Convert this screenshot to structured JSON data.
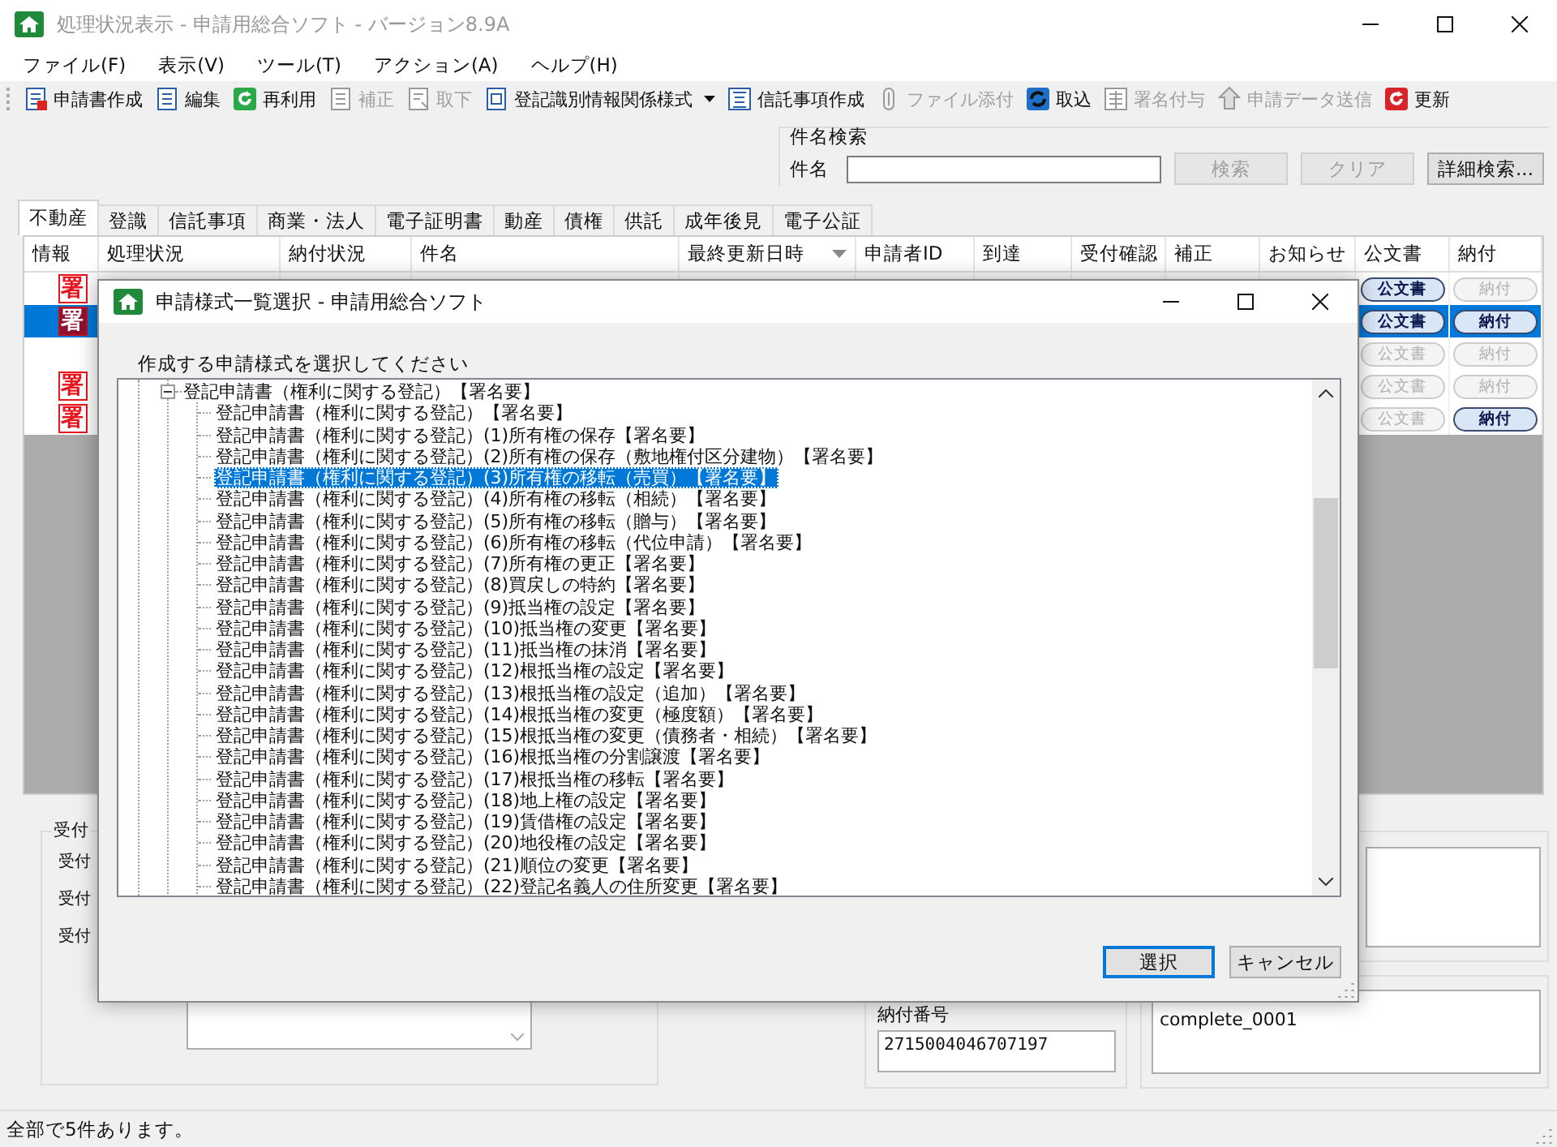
{
  "window": {
    "title": "処理状況表示 - 申請用総合ソフト - バージョン8.9A"
  },
  "menu": [
    "ファイル(F)",
    "表示(V)",
    "ツール(T)",
    "アクション(A)",
    "ヘルプ(H)"
  ],
  "toolbar": [
    {
      "label": "申請書作成",
      "disabled": false,
      "kind": "button"
    },
    {
      "label": "編集",
      "disabled": false,
      "kind": "button"
    },
    {
      "label": "再利用",
      "disabled": false,
      "kind": "button"
    },
    {
      "label": "補正",
      "disabled": true,
      "kind": "button"
    },
    {
      "label": "取下",
      "disabled": true,
      "kind": "button"
    },
    {
      "label": "登記識別情報関係様式",
      "disabled": false,
      "kind": "dropdown"
    },
    {
      "label": "信託事項作成",
      "disabled": false,
      "kind": "button"
    },
    {
      "label": "ファイル添付",
      "disabled": true,
      "kind": "button"
    },
    {
      "label": "取込",
      "disabled": false,
      "kind": "button"
    },
    {
      "label": "署名付与",
      "disabled": true,
      "kind": "button"
    },
    {
      "label": "申請データ送信",
      "disabled": true,
      "kind": "button"
    },
    {
      "label": "更新",
      "disabled": false,
      "kind": "button"
    }
  ],
  "search": {
    "title": "件名検索",
    "label": "件名",
    "buttons": [
      {
        "label": "検索",
        "disabled": true
      },
      {
        "label": "クリア",
        "disabled": true
      },
      {
        "label": "詳細検索...",
        "disabled": false
      }
    ]
  },
  "tabs": [
    {
      "label": "不動産",
      "selected": true
    },
    {
      "label": "登識",
      "selected": false
    },
    {
      "label": "信託事項",
      "selected": false
    },
    {
      "label": "商業・法人",
      "selected": false
    },
    {
      "label": "電子証明書",
      "selected": false
    },
    {
      "label": "動産",
      "selected": false
    },
    {
      "label": "債権",
      "selected": false
    },
    {
      "label": "供託",
      "selected": false
    },
    {
      "label": "成年後見",
      "selected": false
    },
    {
      "label": "電子公証",
      "selected": false
    }
  ],
  "table": {
    "columns": [
      {
        "label": "情報",
        "sorted": false
      },
      {
        "label": "処理状況",
        "sorted": false
      },
      {
        "label": "納付状況",
        "sorted": false
      },
      {
        "label": "件名",
        "sorted": false
      },
      {
        "label": "最終更新日時",
        "sorted": true
      },
      {
        "label": "申請者ID",
        "sorted": false
      },
      {
        "label": "到達",
        "sorted": false
      },
      {
        "label": "受付確認",
        "sorted": false
      },
      {
        "label": "補正",
        "sorted": false
      },
      {
        "label": "お知らせ",
        "sorted": false
      },
      {
        "label": "公文書",
        "sorted": false
      },
      {
        "label": "納付",
        "sorted": false
      }
    ],
    "rows": [
      {
        "stamp": "署",
        "selected": false,
        "official": {
          "label": "公文書",
          "disabled": false
        },
        "payment": {
          "label": "納付",
          "disabled": true
        }
      },
      {
        "stamp": "署",
        "selected": true,
        "official": {
          "label": "公文書",
          "disabled": false
        },
        "payment": {
          "label": "納付",
          "disabled": false
        }
      },
      {
        "selected": false,
        "official": {
          "label": "公文書",
          "disabled": true
        },
        "payment": {
          "label": "納付",
          "disabled": true
        }
      },
      {
        "stamp": "署",
        "selected": false,
        "official": {
          "label": "公文書",
          "disabled": true
        },
        "payment": {
          "label": "納付",
          "disabled": true
        }
      },
      {
        "stamp": "署",
        "selected": false,
        "official": {
          "label": "公文書",
          "disabled": true
        },
        "payment": {
          "label": "納付",
          "disabled": false
        }
      }
    ]
  },
  "details": {
    "group_title": "受付",
    "labels": [
      "受付",
      "受付",
      "受付"
    ],
    "payment_number": {
      "label": "納付番号",
      "value": "2715004046707197"
    },
    "notes": {
      "value": "complete_0001"
    }
  },
  "dialog": {
    "title": "申請様式一覧選択 - 申請用総合ソフト",
    "prompt": "作成する申請様式を選択してください",
    "tree": [
      {
        "label": "登記申請書（権利に関する登記）【署名要】",
        "expanded": true,
        "selected": false,
        "children": [
          {
            "label": "登記申請書（権利に関する登記）【署名要】",
            "selected": false
          },
          {
            "label": "登記申請書（権利に関する登記）(1)所有権の保存【署名要】",
            "selected": false
          },
          {
            "label": "登記申請書（権利に関する登記）(2)所有権の保存（敷地権付区分建物）【署名要】",
            "selected": false
          },
          {
            "label": "登記申請書（権利に関する登記）(3)所有権の移転（売買）【署名要】",
            "selected": true
          },
          {
            "label": "登記申請書（権利に関する登記）(4)所有権の移転（相続）【署名要】",
            "selected": false
          },
          {
            "label": "登記申請書（権利に関する登記）(5)所有権の移転（贈与）【署名要】",
            "selected": false
          },
          {
            "label": "登記申請書（権利に関する登記）(6)所有権の移転（代位申請）【署名要】",
            "selected": false
          },
          {
            "label": "登記申請書（権利に関する登記）(7)所有権の更正【署名要】",
            "selected": false
          },
          {
            "label": "登記申請書（権利に関する登記）(8)買戻しの特約【署名要】",
            "selected": false
          },
          {
            "label": "登記申請書（権利に関する登記）(9)抵当権の設定【署名要】",
            "selected": false
          },
          {
            "label": "登記申請書（権利に関する登記）(10)抵当権の変更【署名要】",
            "selected": false
          },
          {
            "label": "登記申請書（権利に関する登記）(11)抵当権の抹消【署名要】",
            "selected": false
          },
          {
            "label": "登記申請書（権利に関する登記）(12)根抵当権の設定【署名要】",
            "selected": false
          },
          {
            "label": "登記申請書（権利に関する登記）(13)根抵当権の設定（追加）【署名要】",
            "selected": false
          },
          {
            "label": "登記申請書（権利に関する登記）(14)根抵当権の変更（極度額）【署名要】",
            "selected": false
          },
          {
            "label": "登記申請書（権利に関する登記）(15)根抵当権の変更（債務者・相続）【署名要】",
            "selected": false
          },
          {
            "label": "登記申請書（権利に関する登記）(16)根抵当権の分割譲渡【署名要】",
            "selected": false
          },
          {
            "label": "登記申請書（権利に関する登記）(17)根抵当権の移転【署名要】",
            "selected": false
          },
          {
            "label": "登記申請書（権利に関する登記）(18)地上権の設定【署名要】",
            "selected": false
          },
          {
            "label": "登記申請書（権利に関する登記）(19)賃借権の設定【署名要】",
            "selected": false
          },
          {
            "label": "登記申請書（権利に関する登記）(20)地役権の設定【署名要】",
            "selected": false
          },
          {
            "label": "登記申請書（権利に関する登記）(21)順位の変更【署名要】",
            "selected": false
          },
          {
            "label": "登記申請書（権利に関する登記）(22)登記名義人の住所変更【署名要】",
            "selected": false
          }
        ]
      }
    ],
    "buttons": [
      {
        "label": "選択",
        "default": true
      },
      {
        "label": "キャンセル",
        "default": false
      }
    ]
  },
  "status_bar": {
    "text": "全部で5件あります。"
  }
}
